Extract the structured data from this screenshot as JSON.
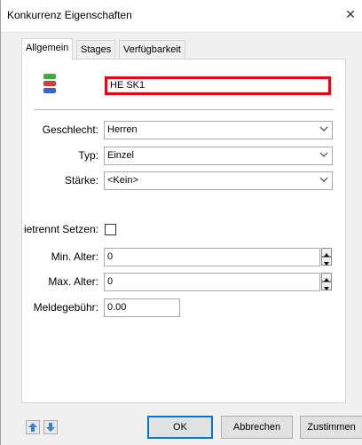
{
  "window": {
    "title": "Konkurrenz Eigenschaften",
    "close_glyph": "✕"
  },
  "tabs": [
    {
      "label": "Allgemein",
      "active": true
    },
    {
      "label": "Stages",
      "active": false
    },
    {
      "label": "Verfügbarkeit",
      "active": false
    }
  ],
  "general": {
    "icon": "colored-stack-icon",
    "name_value": "HE SK1",
    "highlight_color": "#e30613"
  },
  "fields": {
    "geschlecht": {
      "label": "Geschlecht:",
      "value": "Herren"
    },
    "typ": {
      "label": "Typ:",
      "value": "Einzel"
    },
    "staerke": {
      "label": "Stärke:",
      "value": "<Kein>"
    },
    "getrennt": {
      "label": "ietrennt Setzen:",
      "checked": false
    },
    "min_alter": {
      "label": "Min. Alter:",
      "value": "0"
    },
    "max_alter": {
      "label": "Max. Alter:",
      "value": "0"
    },
    "meldegebuehr": {
      "label": "Meldegebühr:",
      "value": "0.00"
    }
  },
  "footer": {
    "up_icon": "arrow-up-icon",
    "down_icon": "arrow-down-icon",
    "ok_label": "OK",
    "cancel_label": "Abbrechen",
    "agree_label": "Zustimmen",
    "accent": "#0078d7"
  }
}
